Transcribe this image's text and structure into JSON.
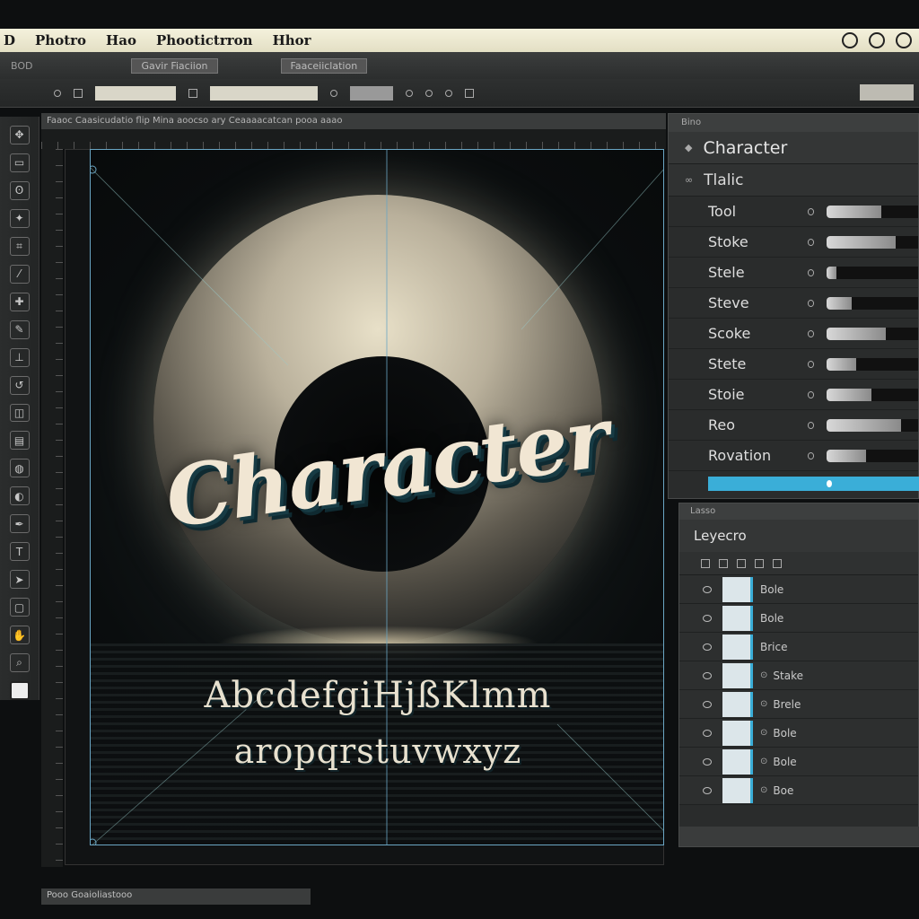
{
  "menubar": {
    "items": [
      "D",
      "Photro",
      "Hao",
      "Phootictrron",
      "Hhor"
    ]
  },
  "options_bar": {
    "row1": [
      "BOD",
      "Gavir Fiaciion",
      "Faaceiiclation"
    ],
    "row2_field1": "",
    "row2_field2": ""
  },
  "document": {
    "tab_title": "Faaoc Caasicudatio flip Mina aoocso ary Ceaaaacatcan pooa aaao",
    "status": "Pooo Goaioliastooo",
    "headline": "Character",
    "alphabet_line1": "AbcdefgiHjßKlmm",
    "alphabet_line2": "aropqrstuvwxyz"
  },
  "character_panel": {
    "tab": "Bino",
    "title": "Character",
    "style": "Tlalic",
    "properties": [
      {
        "label": "Tool",
        "value": 0.55
      },
      {
        "label": "Stoke",
        "value": 0.7
      },
      {
        "label": "Stele",
        "value": 0.1
      },
      {
        "label": "Steve",
        "value": 0.25
      },
      {
        "label": "Scoke",
        "value": 0.6
      },
      {
        "label": "Stete",
        "value": 0.3
      },
      {
        "label": "Stoie",
        "value": 0.45
      },
      {
        "label": "Reo",
        "value": 0.75
      },
      {
        "label": "Rovation",
        "value": 0.4
      }
    ]
  },
  "layers_panel": {
    "tab": "Lasso",
    "title": "Leyecro",
    "layers": [
      {
        "name": "Bole"
      },
      {
        "name": "Bole"
      },
      {
        "name": "Brice"
      },
      {
        "name": "Stake"
      },
      {
        "name": "Brele"
      },
      {
        "name": "Bole"
      },
      {
        "name": "Bole"
      },
      {
        "name": "Boe"
      }
    ]
  }
}
